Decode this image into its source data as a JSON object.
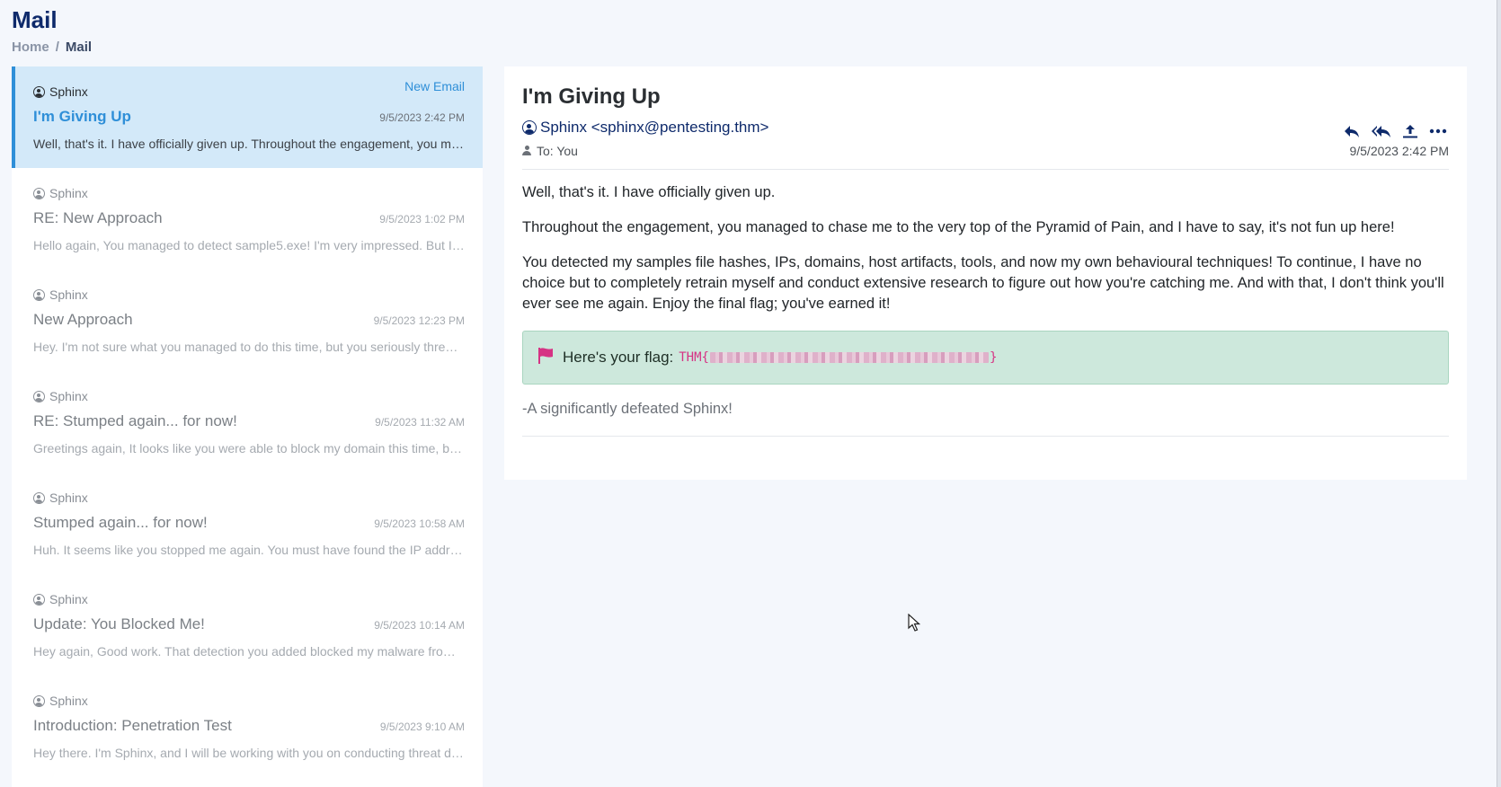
{
  "header": {
    "title": "Mail",
    "breadcrumb": [
      "Home",
      "Mail"
    ],
    "breadcrumb_sep": "/"
  },
  "mail_list": {
    "new_email_label": "New Email",
    "items": [
      {
        "sender": "Sphinx",
        "subject": "I'm Giving Up",
        "date": "9/5/2023 2:42 PM",
        "snippet": "Well, that's it. I have officially given up. Throughout the engagement, you managed to chase me to the very top of the Pyramid of Pain",
        "active": true
      },
      {
        "sender": "Sphinx",
        "subject": "RE: New Approach",
        "date": "9/5/2023 1:02 PM",
        "snippet": "Hello again, You managed to detect sample5.exe! I'm very impressed. But I have one more trick up my sleeve",
        "active": false
      },
      {
        "sender": "Sphinx",
        "subject": "New Approach",
        "date": "9/5/2023 12:23 PM",
        "snippet": "Hey. I'm not sure what you managed to do this time, but you seriously threw a wrench in my plans",
        "active": false
      },
      {
        "sender": "Sphinx",
        "subject": "RE: Stumped again... for now!",
        "date": "9/5/2023 11:32 AM",
        "snippet": "Greetings again, It looks like you were able to block my domain this time, but I will be back",
        "active": false
      },
      {
        "sender": "Sphinx",
        "subject": "Stumped again... for now!",
        "date": "9/5/2023 10:58 AM",
        "snippet": "Huh. It seems like you stopped me again. You must have found the IP address I was using",
        "active": false
      },
      {
        "sender": "Sphinx",
        "subject": "Update: You Blocked Me!",
        "date": "9/5/2023 10:14 AM",
        "snippet": "Hey again, Good work. That detection you added blocked my malware from running on the network",
        "active": false
      },
      {
        "sender": "Sphinx",
        "subject": "Introduction: Penetration Test",
        "date": "9/5/2023 9:10 AM",
        "snippet": "Hey there. I'm Sphinx, and I will be working with you on conducting threat detection exercises",
        "active": false
      }
    ]
  },
  "reader": {
    "subject": "I'm Giving Up",
    "from": "Sphinx <sphinx@pentesting.thm>",
    "to": "To: You",
    "date": "9/5/2023 2:42 PM",
    "paragraphs": [
      "Well, that's it. I have officially given up.",
      "Throughout the engagement, you managed to chase me to the very top of the Pyramid of Pain, and I have to say, it's not fun up here!",
      "You detected my samples file hashes, IPs, domains, host artifacts, tools, and now my own behavioural techniques! To continue, I have no choice but to completely retrain myself and conduct extensive research to figure out how you're catching me. And with that, I don't think you'll ever see me again. Enjoy the final flag; you've earned it!"
    ],
    "flag_label": "Here's your flag:",
    "flag_prefix": "THM{",
    "flag_suffix": "}",
    "signature": "-A significantly defeated Sphinx!"
  },
  "icons": {
    "reply": "reply-icon",
    "reply_all": "reply-all-icon",
    "forward": "upload-icon",
    "more": "more-icon",
    "flag": "flag-icon"
  },
  "colors": {
    "accent": "#2f8fd8",
    "title": "#0e2a6b",
    "flag_bg": "#cde8dc",
    "flag_text": "#d63384"
  }
}
